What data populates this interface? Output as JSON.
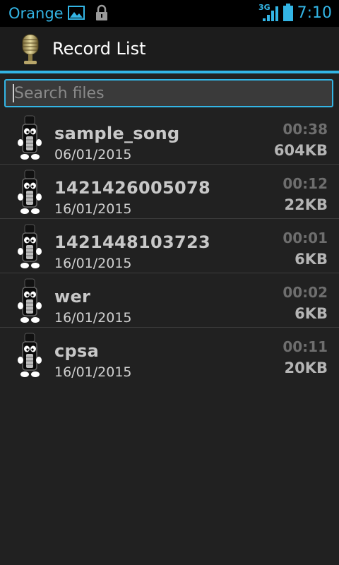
{
  "status_bar": {
    "carrier": "Orange",
    "network": "3G",
    "time": "7:10",
    "accent_color": "#33b5e5"
  },
  "action_bar": {
    "title": "Record List",
    "icon": "microphone-icon"
  },
  "search": {
    "placeholder": "Search files",
    "value": ""
  },
  "recordings": [
    {
      "name": "sample_song",
      "date": "06/01/2015",
      "duration": "00:38",
      "size": "604KB"
    },
    {
      "name": "1421426005078",
      "date": "16/01/2015",
      "duration": "00:12",
      "size": "22KB"
    },
    {
      "name": "1421448103723",
      "date": "16/01/2015",
      "duration": "00:01",
      "size": "6KB"
    },
    {
      "name": "wer",
      "date": "16/01/2015",
      "duration": "00:02",
      "size": "6KB"
    },
    {
      "name": "cpsa",
      "date": "16/01/2015",
      "duration": "00:11",
      "size": "20KB"
    }
  ]
}
